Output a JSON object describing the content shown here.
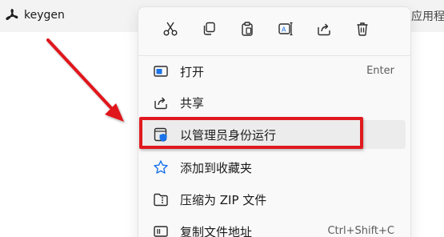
{
  "file": {
    "name": "keygen",
    "icon": "acrobat-pdf-icon"
  },
  "edge_text": "应用程",
  "action_bar": [
    {
      "name": "cut",
      "icon": "scissors-icon"
    },
    {
      "name": "copy",
      "icon": "copy-icon"
    },
    {
      "name": "paste",
      "icon": "clipboard-icon"
    },
    {
      "name": "rename",
      "icon": "rename-icon"
    },
    {
      "name": "share",
      "icon": "share-icon"
    },
    {
      "name": "delete",
      "icon": "trash-icon"
    }
  ],
  "menu_items": [
    {
      "label": "打开",
      "shortcut": "Enter",
      "icon": "open-window-icon"
    },
    {
      "label": "共享",
      "shortcut": "",
      "icon": "share-icon"
    },
    {
      "label": "以管理员身份运行",
      "shortcut": "",
      "icon": "shield-window-icon",
      "highlighted": true
    },
    {
      "label": "添加到收藏夹",
      "shortcut": "",
      "icon": "star-icon"
    },
    {
      "label": "压缩为 ZIP 文件",
      "shortcut": "",
      "icon": "zip-folder-icon"
    },
    {
      "label": "复制文件地址",
      "shortcut": "Ctrl+Shift+C",
      "icon": "path-copy-icon"
    }
  ],
  "colors": {
    "annotation_red": "#e0191f",
    "accent_blue": "#1a73e8"
  }
}
